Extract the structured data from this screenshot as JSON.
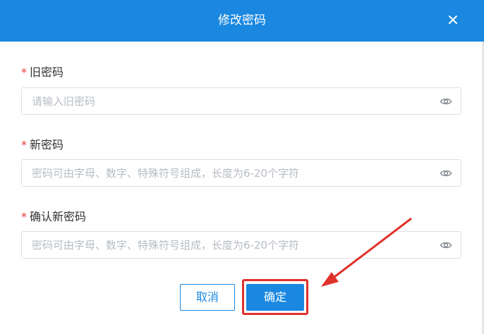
{
  "dialog": {
    "title": "修改密码",
    "close_icon": "close-icon"
  },
  "fields": [
    {
      "required_mark": "*",
      "label": "旧密码",
      "placeholder": "请输入旧密码",
      "value": "",
      "icon": "eye-icon"
    },
    {
      "required_mark": "*",
      "label": "新密码",
      "placeholder": "密码可由字母、数字、特殊符号组成，长度为6-20个字符",
      "value": "",
      "icon": "eye-icon"
    },
    {
      "required_mark": "*",
      "label": "确认新密码",
      "placeholder": "密码可由字母、数字、特殊符号组成，长度为6-20个字符",
      "value": "",
      "icon": "eye-icon"
    }
  ],
  "buttons": {
    "cancel_label": "取消",
    "confirm_label": "确定"
  },
  "colors": {
    "accent": "#1a88e0",
    "required": "#e53935",
    "annotation": "#e0322c"
  }
}
